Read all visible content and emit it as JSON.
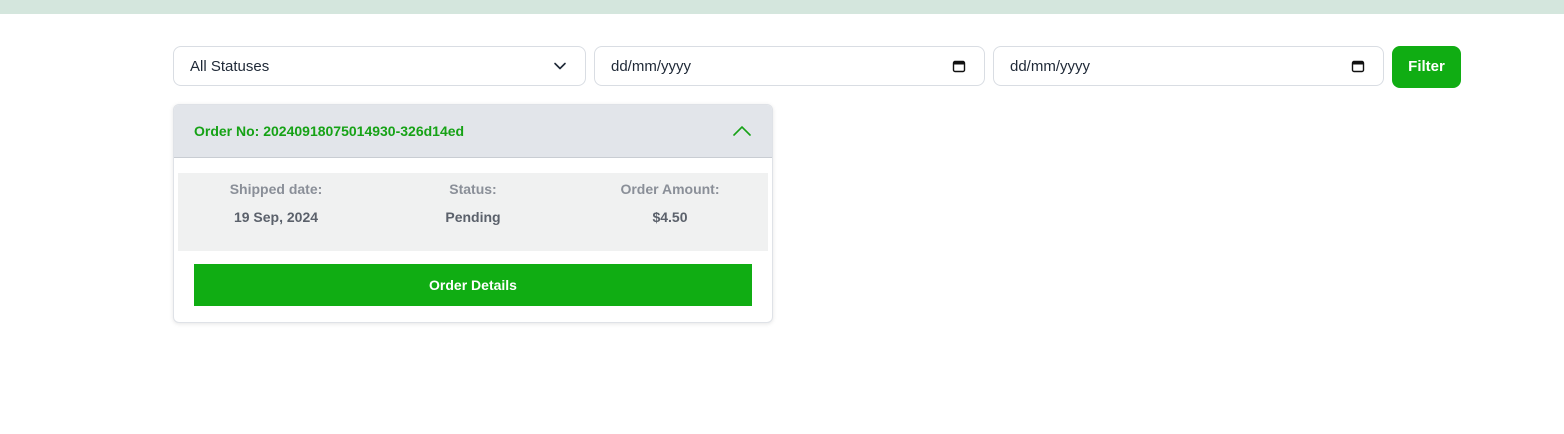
{
  "filters": {
    "status_select": {
      "value": "All Statuses",
      "icon": "chevron-down-icon"
    },
    "date_from": {
      "placeholder": "dd/mm/yyyy",
      "icon": "calendar-icon"
    },
    "date_to": {
      "placeholder": "dd/mm/yyyy",
      "icon": "calendar-icon"
    },
    "filter_label": "Filter"
  },
  "order": {
    "header": "Order No: 20240918075014930-326d14ed",
    "toggle_icon": "chevron-up-icon",
    "shipped_label": "Shipped date:",
    "shipped_value": "19 Sep, 2024",
    "status_label": "Status:",
    "status_value": "Pending",
    "amount_label": "Order Amount:",
    "amount_value": "$4.50",
    "details_label": "Order Details"
  },
  "colors": {
    "accent_green": "#10ad13",
    "header_green_text": "#16a216",
    "top_band": "#d4e6dd"
  }
}
